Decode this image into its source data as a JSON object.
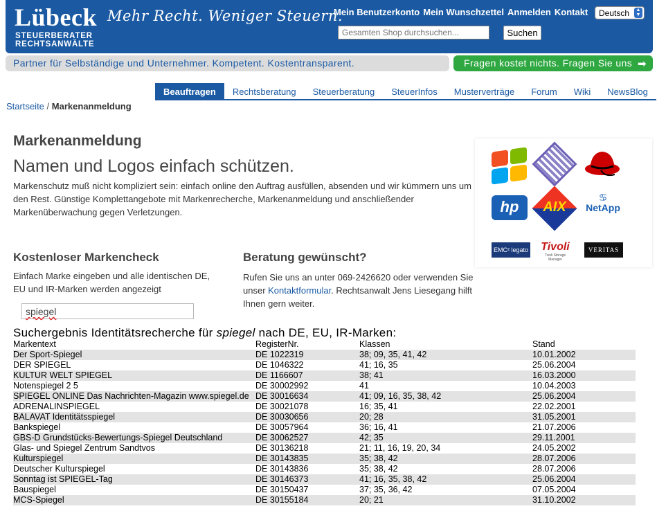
{
  "header": {
    "logo_main": "Lübeck",
    "logo_line1": "STEUERBERATER",
    "logo_line2": "RECHTSANWÄLTE",
    "slogan": "Mehr Recht. Weniger Steuern.",
    "topnav": [
      "Mein Benutzerkonto",
      "Mein Wunschzettel",
      "Anmelden",
      "Kontakt"
    ],
    "language": "Deutsch",
    "search_placeholder": "Gesamten Shop durchsuchen...",
    "search_button": "Suchen"
  },
  "tagline": "Partner für Selbständige und Unternehmer. Kompetent. Kostentransparent.",
  "cta": "Fragen kostet nichts. Fragen Sie uns",
  "tabs": [
    "Beauftragen",
    "Rechtsberatung",
    "Steuerberatung",
    "SteuerInfos",
    "Musterverträge",
    "Forum",
    "Wiki",
    "NewsBlog"
  ],
  "breadcrumb": {
    "home": "Startseite",
    "sep": "/",
    "current": "Markenanmeldung"
  },
  "intro": {
    "title": "Markenanmeldung",
    "subtitle": "Namen und Logos einfach schützen.",
    "text": "Markenschutz muß nicht kompliziert sein: einfach online den Auftrag ausfüllen, absenden und wir kümmern uns um den Rest. Günstige Komplettangebote mit Markenrecherche, Markenanmeldung und anschließender Markenüberwachung gegen Verletzungen."
  },
  "logos": {
    "hp": "hp",
    "aix": "AIX",
    "netapp": "NetApp",
    "legato": "EMC² legato",
    "tivoli": "Tivoli",
    "tivoli_sub": "Tivoli Storage Manager",
    "veritas": "VERITAS"
  },
  "check": {
    "title": "Kostenloser Markencheck",
    "text": "Einfach Marke eingeben und alle identischen DE, EU und IR-Marken werden angezeigt",
    "input_value": "spiegel"
  },
  "advice": {
    "title": "Beratung gewünscht?",
    "text_before": "Rufen Sie uns an unter 069-2426620 oder verwenden Sie unser ",
    "link": "Kontaktformular",
    "text_after": ". Rechtsanwalt Jens Liesegang hilft Ihnen gern weiter."
  },
  "results": {
    "heading_before": "Suchergebnis Identitätsrecherche für ",
    "heading_term": "spiegel",
    "heading_after": " nach DE, EU, IR-Marken:",
    "columns": [
      "Markentext",
      "RegisterNr.",
      "Klassen",
      "Stand"
    ],
    "rows": [
      [
        "Der Sport-Spiegel",
        "DE 1022319",
        "38; 09, 35, 41, 42",
        "10.01.2002"
      ],
      [
        "DER SPIEGEL",
        "DE 1046322",
        "41; 16, 35",
        "25.06.2004"
      ],
      [
        "KULTUR WELT SPIEGEL",
        "DE 1166607",
        "38; 41",
        "16.03.2000"
      ],
      [
        "Notenspiegel 2 5",
        "DE 30002992",
        "41",
        "10.04.2003"
      ],
      [
        "SPIEGEL ONLINE Das Nachrichten-Magazin www.spiegel.de",
        "DE 30016634",
        "41; 09, 16, 35, 38, 42",
        "25.06.2004"
      ],
      [
        "ADRENALINSPIEGEL",
        "DE 30021078",
        "16; 35, 41",
        "22.02.2001"
      ],
      [
        "BALAVAT Identitätsspiegel",
        "DE 30030656",
        "20; 28",
        "31.05.2001"
      ],
      [
        "Bankspiegel",
        "DE 30057964",
        "36; 16, 41",
        "21.07.2006"
      ],
      [
        "GBS-D Grundstücks-Bewertungs-Spiegel Deutschland",
        "DE 30062527",
        "42; 35",
        "29.11.2001"
      ],
      [
        "Glas- und Spiegel Zentrum Sandtvos",
        "DE 30136218",
        "21; 11, 16, 19, 20, 34",
        "24.05.2002"
      ],
      [
        "Kulturspiegel",
        "DE 30143835",
        "35; 38, 42",
        "28.07.2006"
      ],
      [
        "Deutscher Kulturspiegel",
        "DE 30143836",
        "35; 38, 42",
        "28.07.2006"
      ],
      [
        "Sonntag ist SPIEGEL-Tag",
        "DE 30146373",
        "41; 16, 35, 38, 42",
        "25.06.2004"
      ],
      [
        "Bauspiegel",
        "DE 30150437",
        "37; 35, 36, 42",
        "07.05.2004"
      ],
      [
        "MCS-Spiegel",
        "DE 30155184",
        "20; 21",
        "31.10.2002"
      ]
    ]
  }
}
